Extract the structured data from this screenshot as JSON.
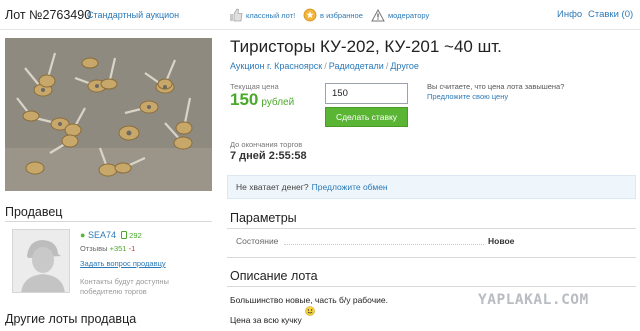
{
  "topbar": {
    "lot_number": "Лот №2763490",
    "auction_type": "Стандартный аукцион",
    "like_label": "классный лот!",
    "favorite_label": "в избранное",
    "moderator_label": "модератору",
    "info_label": "Инфо",
    "bids_label": "Ставки (0)"
  },
  "lot": {
    "title": "Тиристоры КУ-202, КУ-201 ~40 шт.",
    "breadcrumbs": [
      "Аукцион г. Красноярск",
      "Радиодетали",
      "Другое"
    ]
  },
  "price": {
    "caption": "Текущая цена",
    "value": "150",
    "currency": "рублей"
  },
  "bid": {
    "input_value": "150",
    "button_label": "Сделать ставку"
  },
  "overprice": {
    "text": "Вы считаете, что цена лота завышена?",
    "link": "Предложите свою цену"
  },
  "end": {
    "caption": "До окончания торгов",
    "time": "7 дней 2:55:58"
  },
  "money": {
    "text": "Не хватает денег?",
    "link": "Предложите обмен"
  },
  "seller": {
    "heading": "Продавец",
    "name": "SEA74",
    "count": "292",
    "reviews_label": "Отзывы",
    "reviews_pos": "+351",
    "reviews_neg": "-1",
    "ask_question": "Задать вопрос продавцу",
    "contacts_note": "Контакты будут доступны победителю торгов"
  },
  "params": {
    "heading": "Параметры",
    "rows": [
      {
        "label": "Состояние",
        "value": "Новое"
      }
    ]
  },
  "description": {
    "heading": "Описание лота",
    "line1": "Большинство новые, часть б/у рабочие.",
    "line2": "Цена за всю кучку"
  },
  "other_lots": {
    "heading": "Другие лоты продавца"
  },
  "watermark": "YAPLAKAL.COM",
  "colors": {
    "link": "#2b7ab8",
    "price_green": "#4aa92a",
    "button_green": "#5bb534",
    "info_box": "#eef5fb"
  }
}
